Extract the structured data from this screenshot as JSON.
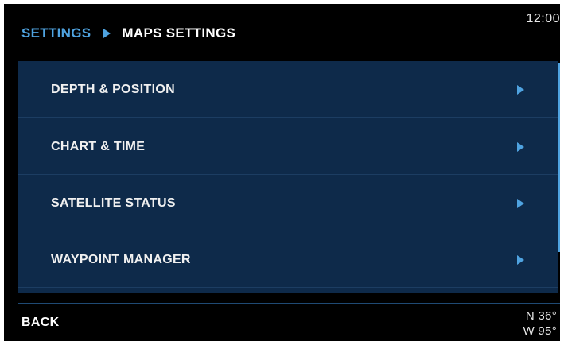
{
  "header": {
    "breadcrumb_root": "SETTINGS",
    "breadcrumb_current": "MAPS SETTINGS",
    "clock": "12:00"
  },
  "menu": {
    "items": [
      {
        "label": "DEPTH & POSITION",
        "icon": "chevron-right-icon"
      },
      {
        "label": "CHART & TIME",
        "icon": "chevron-right-icon"
      },
      {
        "label": "SATELLITE STATUS",
        "icon": "chevron-right-icon"
      },
      {
        "label": "WAYPOINT MANAGER",
        "icon": "chevron-right-icon"
      }
    ]
  },
  "footer": {
    "back_label": "BACK",
    "latitude": "N 36°",
    "longitude": "W 95°"
  },
  "colors": {
    "background": "#000000",
    "panel": "#0e2a4a",
    "accent": "#4fa3e0",
    "text": "#f0f0f0"
  }
}
